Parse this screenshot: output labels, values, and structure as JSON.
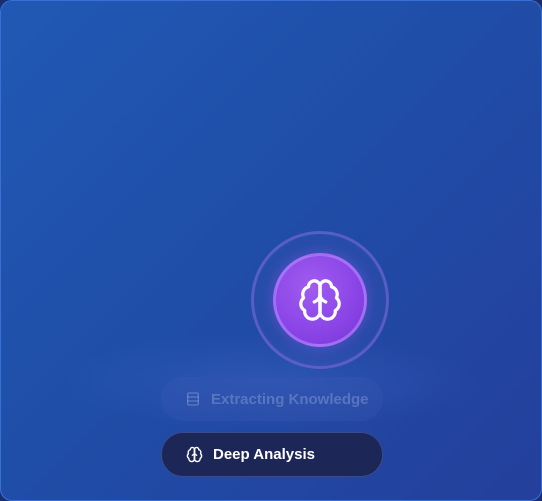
{
  "steps": {
    "previous": {
      "label": "Extracting Knowledge",
      "icon": "database-icon"
    },
    "current": {
      "label": "Deep Analysis",
      "icon": "brain-icon"
    }
  },
  "center": {
    "icon": "brain-icon"
  },
  "colors": {
    "background": "#2059b5",
    "accent": "#8a44e6",
    "active_pill": "#1c2657"
  }
}
